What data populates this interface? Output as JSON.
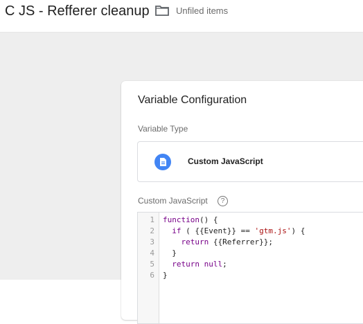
{
  "header": {
    "title": "C JS - Refferer cleanup",
    "folder_label": "Unfiled items"
  },
  "card": {
    "title": "Variable Configuration",
    "variable_type_label": "Variable Type",
    "variable_type_value": "Custom JavaScript",
    "code_label": "Custom JavaScript",
    "help_glyph": "?"
  },
  "code": {
    "lines": [
      {
        "n": "1",
        "parts": [
          {
            "t": "kw",
            "s": "function"
          },
          {
            "t": "pl",
            "s": "() {"
          }
        ]
      },
      {
        "n": "2",
        "parts": [
          {
            "t": "pl",
            "s": "  "
          },
          {
            "t": "kw",
            "s": "if"
          },
          {
            "t": "pl",
            "s": " ( {{Event}} == "
          },
          {
            "t": "str",
            "s": "'gtm.js'"
          },
          {
            "t": "pl",
            "s": ") {"
          }
        ]
      },
      {
        "n": "3",
        "parts": [
          {
            "t": "pl",
            "s": "    "
          },
          {
            "t": "kw",
            "s": "return"
          },
          {
            "t": "pl",
            "s": " {{Referrer}};"
          }
        ]
      },
      {
        "n": "4",
        "parts": [
          {
            "t": "pl",
            "s": "  }"
          }
        ]
      },
      {
        "n": "5",
        "parts": [
          {
            "t": "pl",
            "s": "  "
          },
          {
            "t": "kw",
            "s": "return"
          },
          {
            "t": "pl",
            "s": " "
          },
          {
            "t": "kw",
            "s": "null"
          },
          {
            "t": "pl",
            "s": ";"
          }
        ]
      },
      {
        "n": "6",
        "parts": [
          {
            "t": "pl",
            "s": "}"
          }
        ]
      }
    ]
  },
  "colors": {
    "accent": "#4285f4",
    "keyword": "#770088",
    "string": "#aa1111",
    "background": "#eeeeee"
  },
  "icons": [
    "folder-icon",
    "document-icon",
    "help-icon"
  ]
}
